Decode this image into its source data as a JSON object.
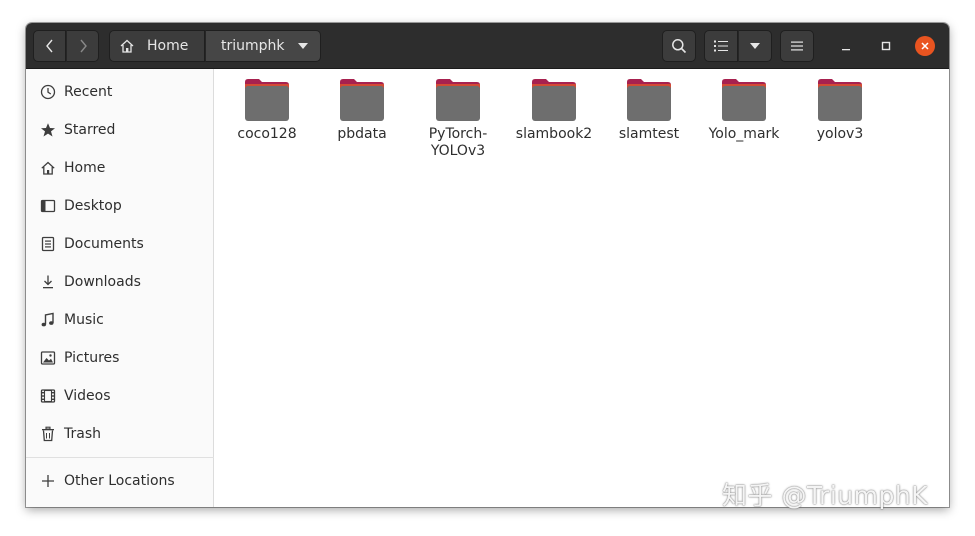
{
  "pathbar": {
    "home_label": "Home",
    "current_label": "triumphk"
  },
  "sidebar": {
    "items": [
      {
        "label": "Recent",
        "icon": "clock-icon"
      },
      {
        "label": "Starred",
        "icon": "star-icon"
      },
      {
        "label": "Home",
        "icon": "home-icon"
      },
      {
        "label": "Desktop",
        "icon": "desktop-icon"
      },
      {
        "label": "Documents",
        "icon": "document-icon"
      },
      {
        "label": "Downloads",
        "icon": "download-icon"
      },
      {
        "label": "Music",
        "icon": "music-icon"
      },
      {
        "label": "Pictures",
        "icon": "picture-icon"
      },
      {
        "label": "Videos",
        "icon": "video-icon"
      },
      {
        "label": "Trash",
        "icon": "trash-icon"
      }
    ],
    "other_locations": "Other Locations"
  },
  "folders": [
    {
      "name": "coco128"
    },
    {
      "name": "pbdata"
    },
    {
      "name": "PyTorch-YOLOv3"
    },
    {
      "name": "slambook2"
    },
    {
      "name": "slamtest"
    },
    {
      "name": "Yolo_mark"
    },
    {
      "name": "yolov3"
    }
  ],
  "watermark": "知乎 @TriumphK",
  "colors": {
    "headerbar": "#2d2d2d",
    "close_button": "#e95420",
    "folder_body": "#6e6e6e",
    "folder_tab": "#a7214f"
  }
}
